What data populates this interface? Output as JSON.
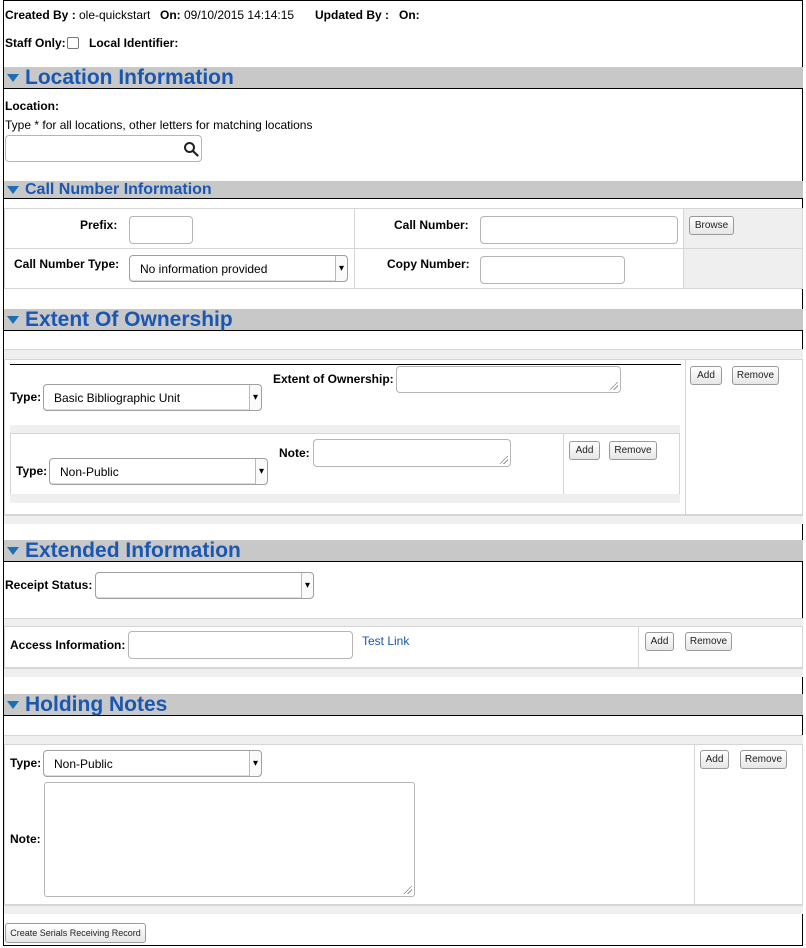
{
  "meta": {
    "created_by_label": "Created By :",
    "created_by_value": "ole-quickstart",
    "on_label": "On:",
    "created_on_value": "09/10/2015 14:14:15",
    "updated_by_label": "Updated By :",
    "updated_on_label": "On:",
    "staff_only_label": "Staff Only:",
    "local_identifier_label": "Local Identifier:"
  },
  "location": {
    "title": "Location Information",
    "location_label": "Location:",
    "hint": "Type * for all locations, other letters for matching locations",
    "search_value": ""
  },
  "call_number": {
    "title": "Call Number Information",
    "prefix_label": "Prefix:",
    "call_number_label": "Call Number:",
    "browse_label": "Browse",
    "call_number_type_label": "Call Number Type:",
    "call_number_type_value": "No information provided",
    "copy_number_label": "Copy Number:"
  },
  "extent": {
    "title": "Extent Of Ownership",
    "type_label": "Type:",
    "type_value": "Basic Bibliographic Unit",
    "extent_label": "Extent of Ownership:",
    "add_label": "Add",
    "remove_label": "Remove",
    "note_type_label": "Type:",
    "note_type_value": "Non-Public",
    "note_label": "Note:",
    "note_add_label": "Add",
    "note_remove_label": "Remove"
  },
  "extended": {
    "title": "Extended Information",
    "receipt_status_label": "Receipt Status:",
    "receipt_status_value": "",
    "access_info_label": "Access Information:",
    "test_link_label": "Test Link",
    "add_label": "Add",
    "remove_label": "Remove"
  },
  "holding_notes": {
    "title": "Holding Notes",
    "type_label": "Type:",
    "type_value": "Non-Public",
    "note_label": "Note:",
    "add_label": "Add",
    "remove_label": "Remove"
  },
  "footer": {
    "create_button_label": "Create Serials Receiving Record"
  },
  "colors": {
    "section_title": "#1a57b0",
    "section_bar": "#c8c8c8",
    "triangle": "#1a6fb5"
  }
}
